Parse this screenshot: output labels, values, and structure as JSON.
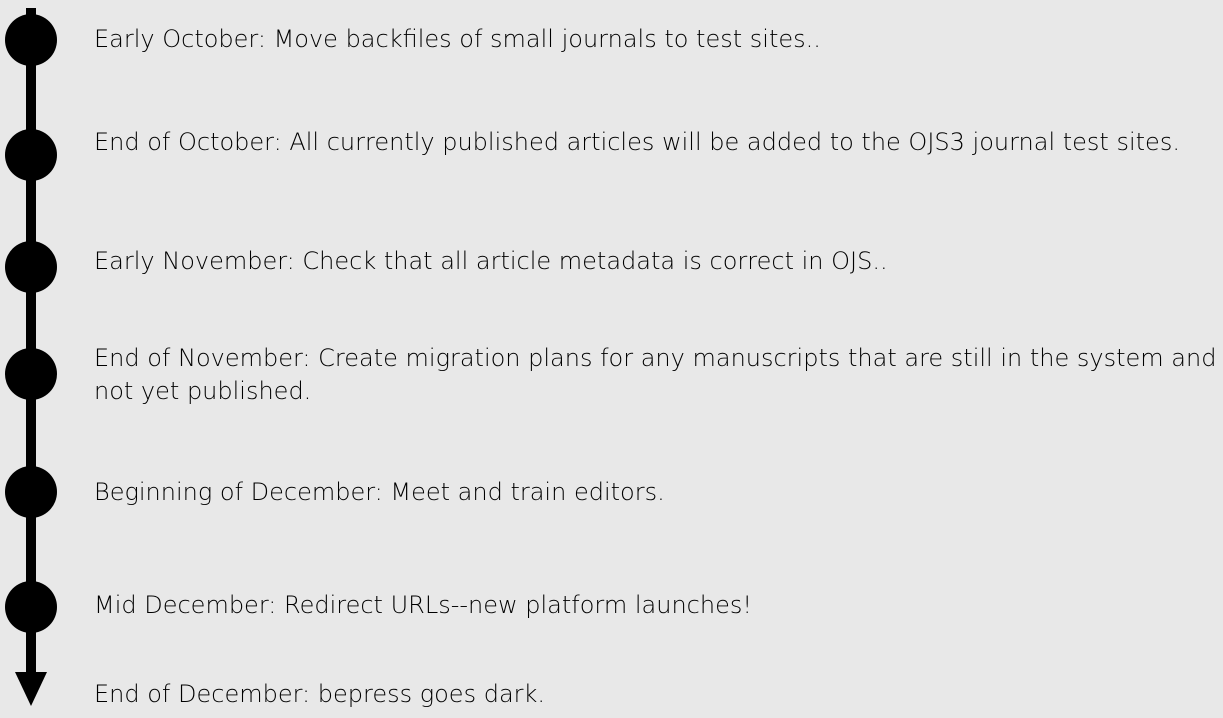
{
  "timeline": {
    "events": [
      {
        "text": "Early October: Move backfiles of small journals to test sites.."
      },
      {
        "text": "End of October: All currently published articles will be added to the OJS3 journal test sites."
      },
      {
        "text": "Early November: Check that all article metadata is correct in OJS.."
      },
      {
        "text": "End of November: Create migration plans for any manuscripts that are still in the system and not yet published."
      },
      {
        "text": "Beginning of December: Meet and train editors."
      },
      {
        "text": "Mid December: Redirect URLs--new platform launches!"
      },
      {
        "text": "End of December: bepress goes dark."
      }
    ]
  }
}
